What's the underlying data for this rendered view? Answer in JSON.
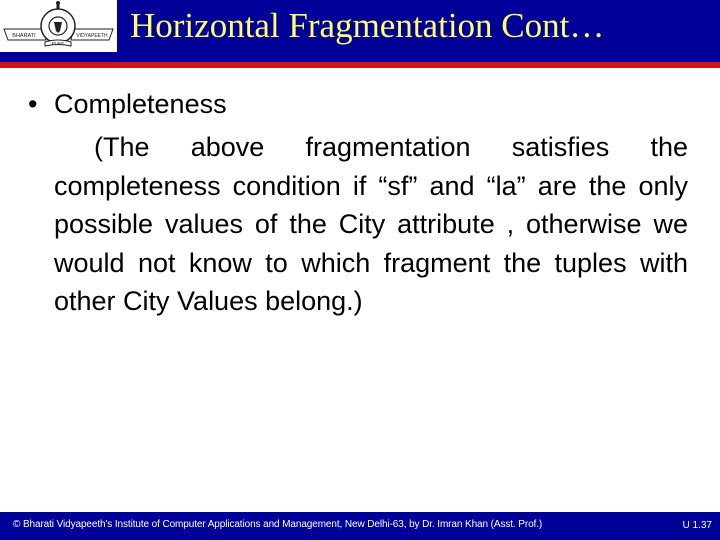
{
  "header": {
    "logo": {
      "icon": "bharati-vidyapeeth-logo-icon",
      "left_text": "BHARATI",
      "right_text": "VIDYAPEETH",
      "bottom_text": "PUNE"
    },
    "title": "Horizontal Fragmentation Cont…"
  },
  "content": {
    "bullet": "Completeness",
    "bullet_icon": "•",
    "paragraph": "(The above fragmentation satisfies the completeness condition if “sf” and “la” are the only possible values of the City attribute , otherwise we would not know to which fragment the tuples with other City Values belong.)"
  },
  "footer": {
    "credit": "© Bharati Vidyapeeth's Institute of Computer Applications and Management, New Delhi-63,  by  Dr. Imran Khan (Asst. Prof.)",
    "slide_number": "U 1.37"
  },
  "colors": {
    "band_blue": "#000099",
    "accent_red": "#d0101a",
    "title_yellow": "#ffff66",
    "text": "#000000"
  }
}
